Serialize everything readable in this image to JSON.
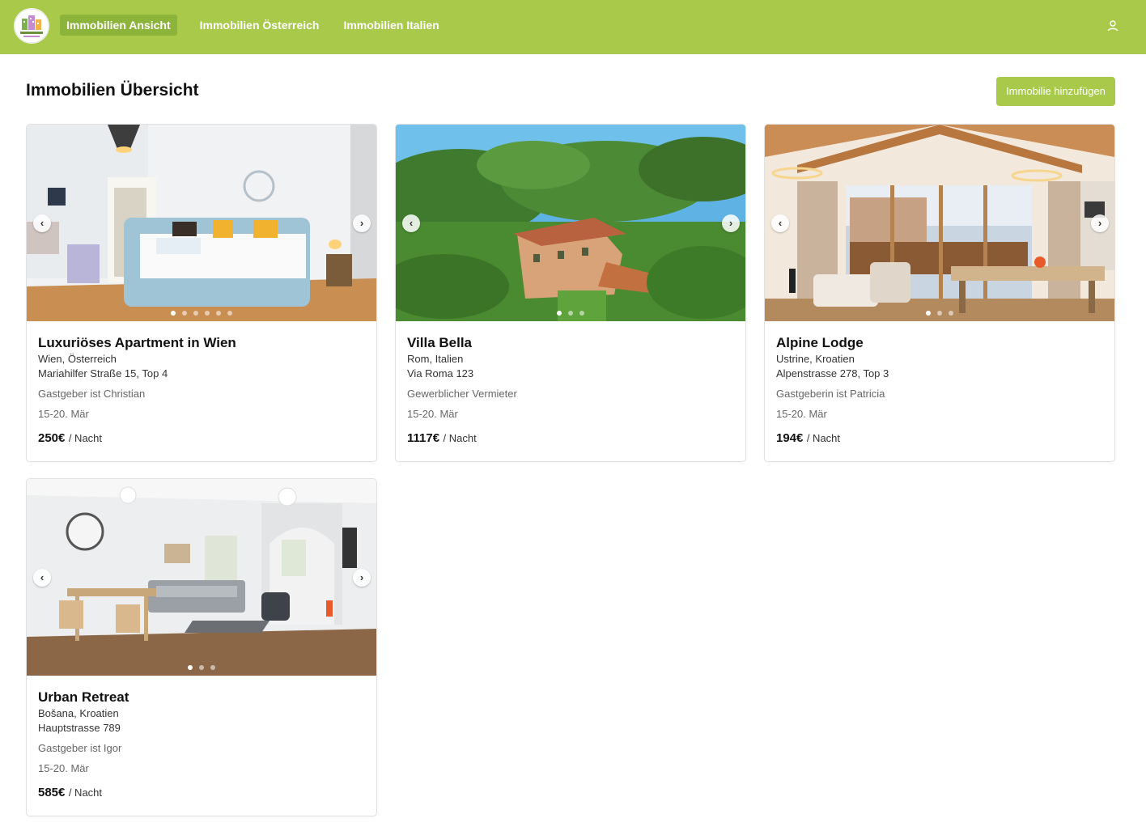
{
  "nav": {
    "logo_text": "EQUILIBRA",
    "items": [
      {
        "label": "Immobilien Ansicht",
        "active": true
      },
      {
        "label": "Immobilien Österreich",
        "active": false
      },
      {
        "label": "Immobilien Italien",
        "active": false
      }
    ],
    "user_icon": "user-icon"
  },
  "page": {
    "title": "Immobilien Übersicht",
    "add_button": "Immobilie hinzufügen"
  },
  "colors": {
    "brand_green": "#a8c94a",
    "active_nav": "#8cb33a"
  },
  "properties": [
    {
      "title": "Luxuriöses Apartment in Wien",
      "location": "Wien, Österreich",
      "address": "Mariahilfer Straße 15, Top 4",
      "host": "Gastgeber ist Christian",
      "dates": "15-20. Mär",
      "price": "250€",
      "price_unit": "/ Nacht",
      "image_count": 6,
      "active_image": 1
    },
    {
      "title": "Villa Bella",
      "location": "Rom, Italien",
      "address": "Via Roma 123",
      "host": "Gewerblicher Vermieter",
      "dates": "15-20. Mär",
      "price": "1117€",
      "price_unit": "/ Nacht",
      "image_count": 3,
      "active_image": 1
    },
    {
      "title": "Alpine Lodge",
      "location": "Ustrine, Kroatien",
      "address": "Alpenstrasse 278, Top 3",
      "host": "Gastgeberin ist Patricia",
      "dates": "15-20. Mär",
      "price": "194€",
      "price_unit": "/ Nacht",
      "image_count": 3,
      "active_image": 1
    },
    {
      "title": "Urban Retreat",
      "location": "Bošana, Kroatien",
      "address": "Hauptstrasse 789",
      "host": "Gastgeber ist Igor",
      "dates": "15-20. Mär",
      "price": "585€",
      "price_unit": "/ Nacht",
      "image_count": 3,
      "active_image": 1
    }
  ]
}
